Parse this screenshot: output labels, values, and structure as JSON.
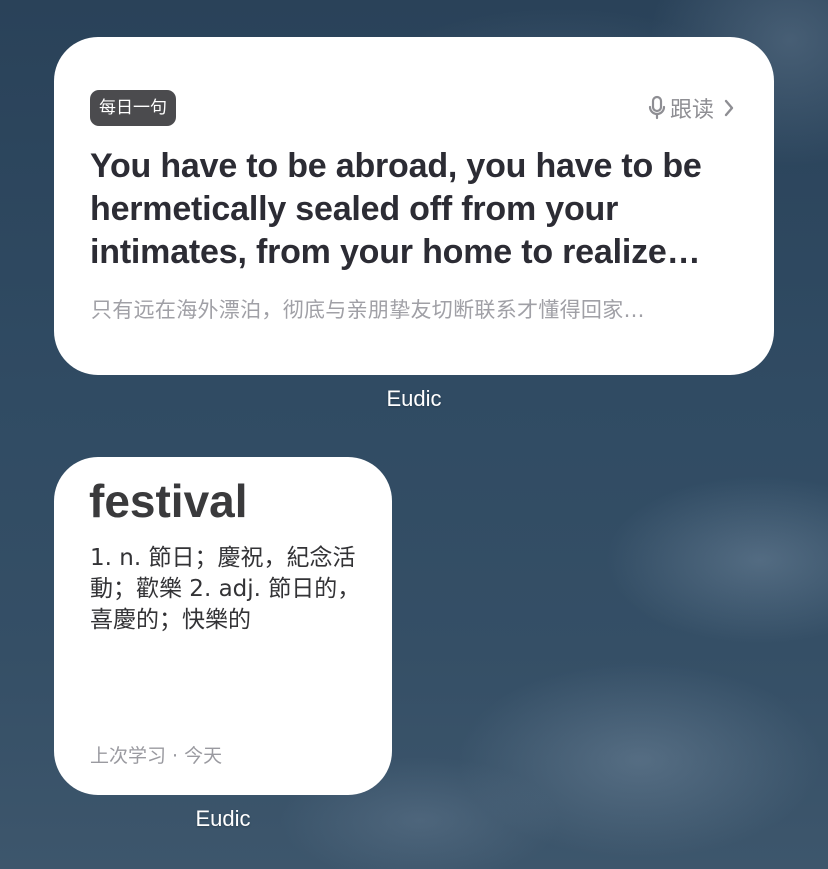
{
  "daily_widget": {
    "badge": "每日一句",
    "follow_read": "跟读",
    "follow_icon": "microphone-icon",
    "chevron_icon": "chevron-right-icon",
    "quote_en": "You have to be abroad, you have to be hermetically sealed off from your intimates, from your home to realize…",
    "quote_cn": "只有远在海外漂泊，彻底与亲朋挚友切断联系才懂得回家…",
    "app_label": "Eudic"
  },
  "word_widget": {
    "word": "festival",
    "definition": "1. n. 節日；慶祝，紀念活動；歡樂  2. adj. 節日的，喜慶的；快樂的",
    "last_study": "上次学习 · 今天",
    "app_label": "Eudic"
  },
  "colors": {
    "widget_bg": "#ffffff",
    "badge_bg": "#4b4b4e",
    "secondary_text": "#8e8e93",
    "primary_text": "#2c2c34"
  }
}
